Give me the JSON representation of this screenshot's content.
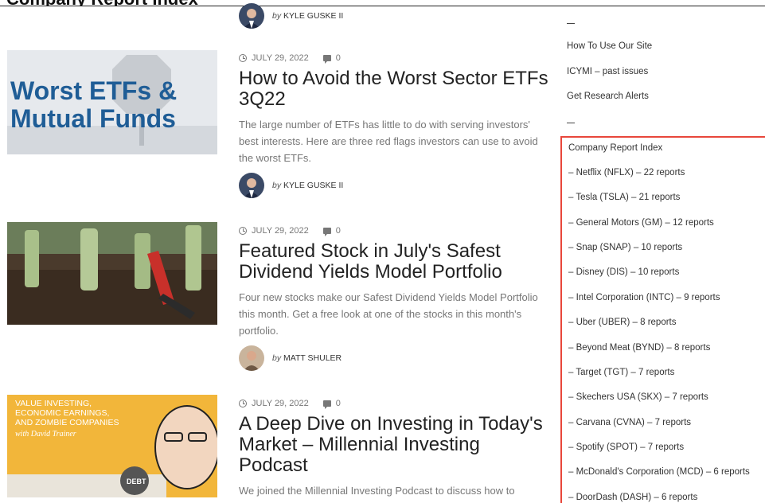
{
  "page": {
    "top_title": "Company Report Index",
    "colors": {
      "accent_border": "#e8473b",
      "text": "#333333",
      "muted": "#777777"
    }
  },
  "articles": [
    {
      "author_prefix": "by",
      "author": "KYLE GUSKE II"
    },
    {
      "date": "JULY 29, 2022",
      "comments": "0",
      "title": "How to Avoid the Worst Sector ETFs 3Q22",
      "excerpt": "The large number of ETFs has little to do with serving investors' best interests. Here are three red flags investors can use to avoid the worst ETFs.",
      "author_prefix": "by",
      "author": "KYLE GUSKE II",
      "thumb_text": [
        "Worst ETFs &",
        "Mutual Funds"
      ]
    },
    {
      "date": "JULY 29, 2022",
      "comments": "0",
      "title": "Featured Stock in July's Safest Dividend Yields Model Portfolio",
      "excerpt": "Four new stocks make our Safest Dividend Yields Model Portfolio this month. Get a free look at one of the stocks in this month's portfolio.",
      "author_prefix": "by",
      "author": "MATT SHULER"
    },
    {
      "date": "JULY 29, 2022",
      "comments": "0",
      "title": "A Deep Dive on Investing in Today's Market – Millennial Investing Podcast",
      "excerpt": "We joined the Millennial Investing Podcast to discuss how to",
      "thumb_text": [
        "VALUE INVESTING,",
        "ECONOMIC EARNINGS,",
        "AND ZOMBIE COMPANIES",
        "with David Trainer",
        "DEBT"
      ]
    }
  ],
  "sidebar": {
    "dash_1": "—",
    "links": [
      "How To Use Our Site",
      "ICYMI – past issues",
      "Get Research Alerts"
    ],
    "dash_2": "—",
    "report_index_title": "Company Report Index",
    "reports": [
      "– Netflix (NFLX) – 22 reports",
      "– Tesla (TSLA) – 21 reports",
      "– General Motors (GM) – 12 reports",
      "– Snap (SNAP) – 10 reports",
      "– Disney (DIS) – 10 reports",
      "– Intel Corporation (INTC) – 9 reports",
      "– Uber (UBER) – 8 reports",
      "– Beyond Meat (BYND) – 8 reports",
      "– Target (TGT) – 7 reports",
      "– Skechers USA (SKX) – 7 reports",
      "– Carvana (CVNA) – 7 reports",
      "– Spotify (SPOT) – 7 reports",
      "– McDonald's Corporation (MCD) – 6 reports",
      "– DoorDash (DASH) – 6 reports"
    ]
  }
}
